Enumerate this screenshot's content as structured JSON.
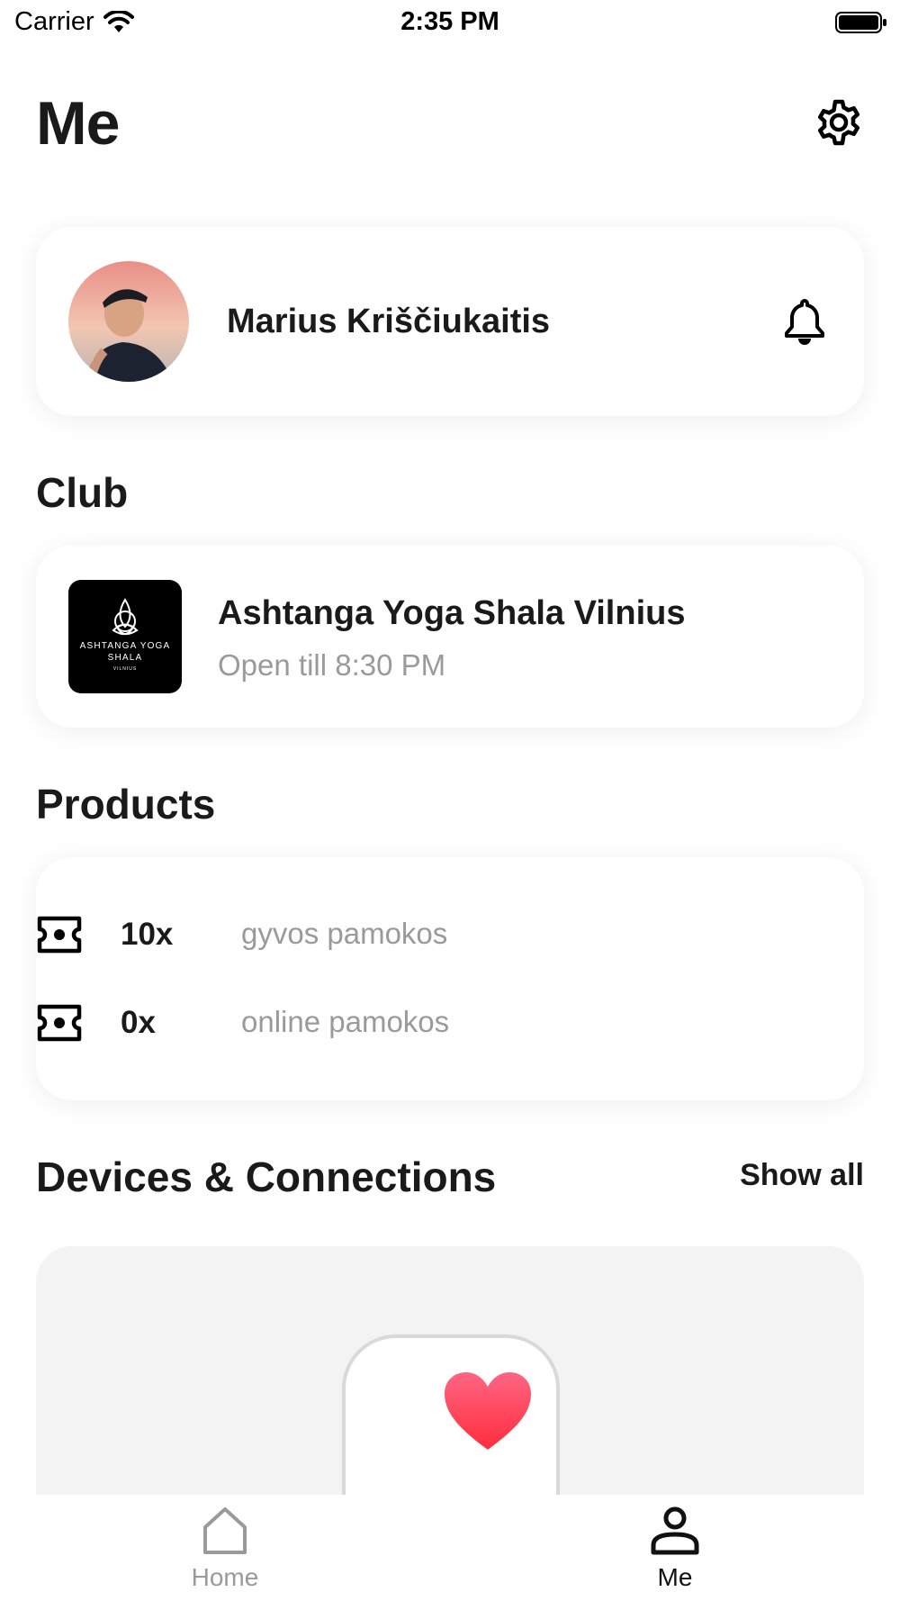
{
  "status_bar": {
    "carrier": "Carrier",
    "time": "2:35 PM"
  },
  "header": {
    "title": "Me"
  },
  "profile": {
    "name": "Marius Kriščiukaitis"
  },
  "club": {
    "section_title": "Club",
    "name": "Ashtanga Yoga Shala Vilnius",
    "hours": "Open till 8:30 PM",
    "logo_text_line1": "ASHTANGA YOGA",
    "logo_text_line2": "SHALA",
    "logo_text_line3": "VILNIUS"
  },
  "products": {
    "section_title": "Products",
    "items": [
      {
        "count": "10x",
        "label": "gyvos pamokos"
      },
      {
        "count": "0x",
        "label": "online pamokos"
      }
    ]
  },
  "devices": {
    "section_title": "Devices & Connections",
    "show_all_label": "Show all"
  },
  "tab_bar": {
    "tabs": [
      {
        "label": "Home",
        "icon": "home-icon",
        "active": false
      },
      {
        "label": "Me",
        "icon": "person-icon",
        "active": true
      }
    ]
  },
  "colors": {
    "heart": "#ff3b5c",
    "muted_text": "#9a9a9a",
    "card_bg_muted": "#f3f3f3"
  }
}
